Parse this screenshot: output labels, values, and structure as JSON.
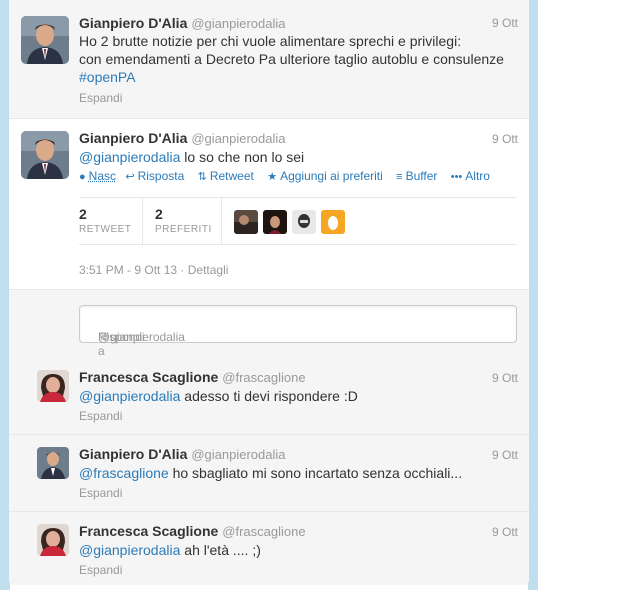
{
  "tweets": [
    {
      "name": "Gianpiero D'Alia",
      "handle": "@gianpierodalia",
      "time": "9 Ott",
      "line1": "Ho 2 brutte notizie per chi vuole alimentare sprechi e privilegi:",
      "line2": "con emendamenti a Decreto Pa ulteriore taglio autoblu e consulenze",
      "hashtag": "#openPA",
      "expand": "Espandi"
    },
    {
      "name": "Gianpiero D'Alia",
      "handle": "@gianpierodalia",
      "time": "9 Ott",
      "mention": "@gianpierodalia",
      "text": " lo so che non lo sei",
      "actions": {
        "hide": "Nasc",
        "reply": "Risposta",
        "retweet": "Retweet",
        "favorite": "Aggiungi ai preferiti",
        "buffer": "Buffer",
        "more": "Altro"
      },
      "retweets_count": "2",
      "retweets_label": "RETWEET",
      "favorites_count": "2",
      "favorites_label": "PREFERITI",
      "timestamp": "3:51 PM - 9 Ott 13",
      "details": "Dettagli"
    }
  ],
  "reply": {
    "prefix": "Rispondi a ",
    "mention": "@gianpierodalia"
  },
  "replies": [
    {
      "name": "Francesca Scaglione",
      "handle": "@frascaglione",
      "time": "9 Ott",
      "mention": "@gianpierodalia",
      "text": " adesso ti devi rispondere :D",
      "expand": "Espandi"
    },
    {
      "name": "Gianpiero D'Alia",
      "handle": "@gianpierodalia",
      "time": "9 Ott",
      "mention": "@frascaglione",
      "text": " ho sbagliato mi sono incartato senza occhiali...",
      "expand": "Espandi"
    },
    {
      "name": "Francesca Scaglione",
      "handle": "@frascaglione",
      "time": "9 Ott",
      "mention": "@gianpierodalia",
      "text": " ah l'età .... ;)",
      "expand": "Espandi"
    }
  ],
  "colors": {
    "link": "#2b7bb9",
    "muted": "#999999",
    "background": "#c0deed"
  }
}
